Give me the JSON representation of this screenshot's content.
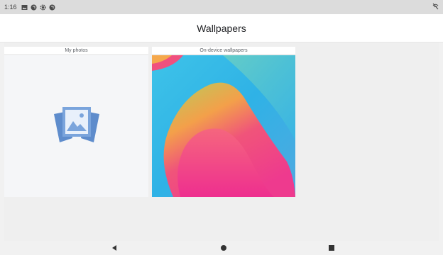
{
  "status_bar": {
    "time": "1:16",
    "icons": [
      "image-icon",
      "sync-icon",
      "settings-icon",
      "sync-icon"
    ],
    "right_icon": "wifi-off-icon"
  },
  "app_bar": {
    "title": "Wallpapers"
  },
  "sections": {
    "my_photos": {
      "label": "My photos",
      "icon": "photo-stack-icon"
    },
    "on_device": {
      "label": "On-device wallpapers"
    }
  },
  "colors": {
    "photo_icon": "#6f9bd5",
    "wallpaper_bg": "#37b9e8"
  },
  "nav_bar": {
    "icons": [
      "back-icon",
      "home-icon",
      "recents-icon"
    ]
  }
}
